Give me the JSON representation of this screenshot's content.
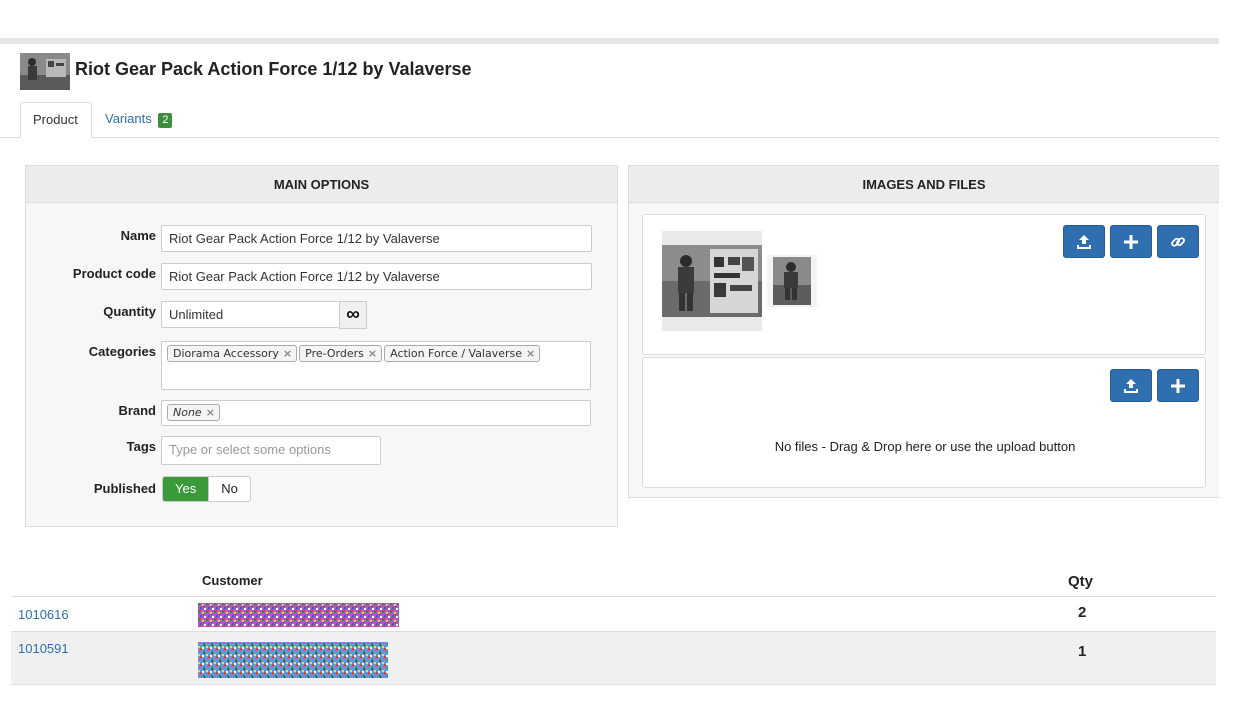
{
  "product": {
    "title": "Riot Gear Pack Action Force 1/12 by Valaverse"
  },
  "tabs": [
    {
      "label": "Product",
      "active": true
    },
    {
      "label": "Variants",
      "badge": "2",
      "active": false
    }
  ],
  "main_options": {
    "heading": "MAIN OPTIONS",
    "name_label": "Name",
    "name_value": "Riot Gear Pack Action Force 1/12 by Valaverse",
    "code_label": "Product code",
    "code_value": "Riot Gear Pack Action Force 1/12 by Valaverse",
    "quantity_label": "Quantity",
    "quantity_value": "Unlimited",
    "quantity_icon": "infinity-icon",
    "categories_label": "Categories",
    "categories": [
      "Diorama Accessory",
      "Pre-Orders",
      "Action Force / Valaverse"
    ],
    "brand_label": "Brand",
    "brand_value": "None",
    "tags_label": "Tags",
    "tags_placeholder": "Type or select some options",
    "published_label": "Published",
    "published_yes": "Yes",
    "published_no": "No",
    "published_value": "Yes"
  },
  "images_files": {
    "heading": "IMAGES AND FILES",
    "image_buttons": [
      "upload-icon",
      "plus-icon",
      "link-icon"
    ],
    "file_buttons": [
      "upload-icon",
      "plus-icon"
    ],
    "no_files_text": "No files - Drag & Drop here or use the upload button"
  },
  "orders": {
    "customer_header": "Customer",
    "qty_header": "Qty",
    "rows": [
      {
        "id": "1010616",
        "qty": "2"
      },
      {
        "id": "1010591",
        "qty": "1"
      }
    ]
  },
  "colors": {
    "primary_button": "#2f6fb0",
    "success": "#3a9a3a",
    "link": "#2a6fb0"
  }
}
